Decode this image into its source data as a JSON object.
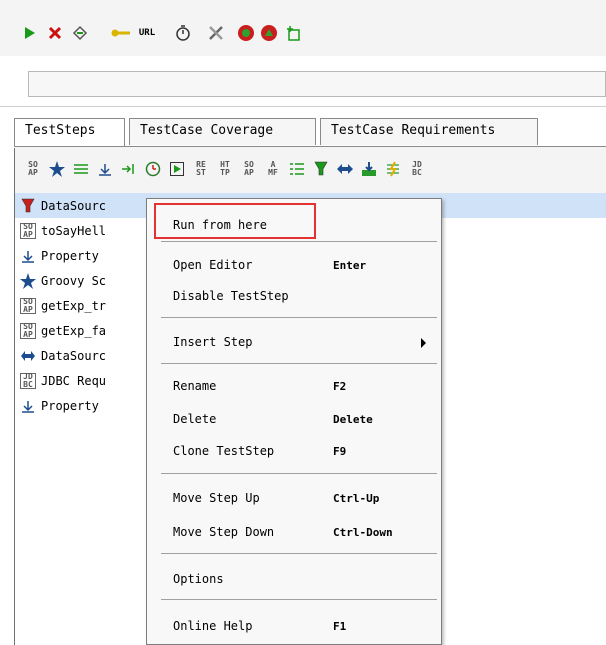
{
  "toolbar": {
    "url_label": "URL",
    "icons": [
      "run-icon",
      "cancel-icon",
      "options-icon",
      "endpoint-icon",
      "url-icon",
      "timer-icon",
      "settings-icon",
      "monitor-icon",
      "loadtest-icon",
      "add-icon"
    ]
  },
  "tabs": [
    {
      "label": "TestSteps",
      "active": true
    },
    {
      "label": "TestCase Coverage",
      "active": false
    },
    {
      "label": "TestCase Requirements",
      "active": false
    }
  ],
  "step_toolbar": {
    "soap": "SO\nAP",
    "rest": "RE\nST",
    "http": "HT\nTP",
    "amf": "A\nMF",
    "jdbc": "JD\nBC"
  },
  "steps": [
    {
      "label": "DataSourc",
      "icon": "datasource-icon",
      "selected": true
    },
    {
      "label": "toSayHell",
      "icon": "soap-icon",
      "selected": false
    },
    {
      "label": "Property",
      "icon": "property-transfer-icon",
      "selected": false
    },
    {
      "label": "Groovy Sc",
      "icon": "groovy-icon",
      "selected": false
    },
    {
      "label": "getExp_tr",
      "icon": "soap-icon",
      "selected": false
    },
    {
      "label": "getExp_fa",
      "icon": "soap-icon",
      "selected": false
    },
    {
      "label": "DataSourc",
      "icon": "datasource-loop-icon",
      "selected": false
    },
    {
      "label": "JDBC Requ",
      "icon": "jdbc-icon",
      "selected": false
    },
    {
      "label": "Property",
      "icon": "property-transfer-icon",
      "selected": false
    }
  ],
  "context_menu": {
    "run_from_here": "Run from here",
    "open_editor": "Open Editor",
    "open_editor_sc": "Enter",
    "disable_step": "Disable TestStep",
    "insert_step": "Insert Step",
    "rename": "Rename",
    "rename_sc": "F2",
    "delete": "Delete",
    "delete_sc": "Delete",
    "clone": "Clone TestStep",
    "clone_sc": "F9",
    "move_up": "Move Step Up",
    "move_up_sc": "Ctrl-Up",
    "move_down": "Move Step Down",
    "move_down_sc": "Ctrl-Down",
    "options": "Options",
    "online_help": "Online Help",
    "online_help_sc": "F1"
  },
  "colors": {
    "selection": "#cfe2f7",
    "highlight_border": "#e23232",
    "run_green": "#1a9a1a",
    "cancel_red": "#cc1010"
  }
}
